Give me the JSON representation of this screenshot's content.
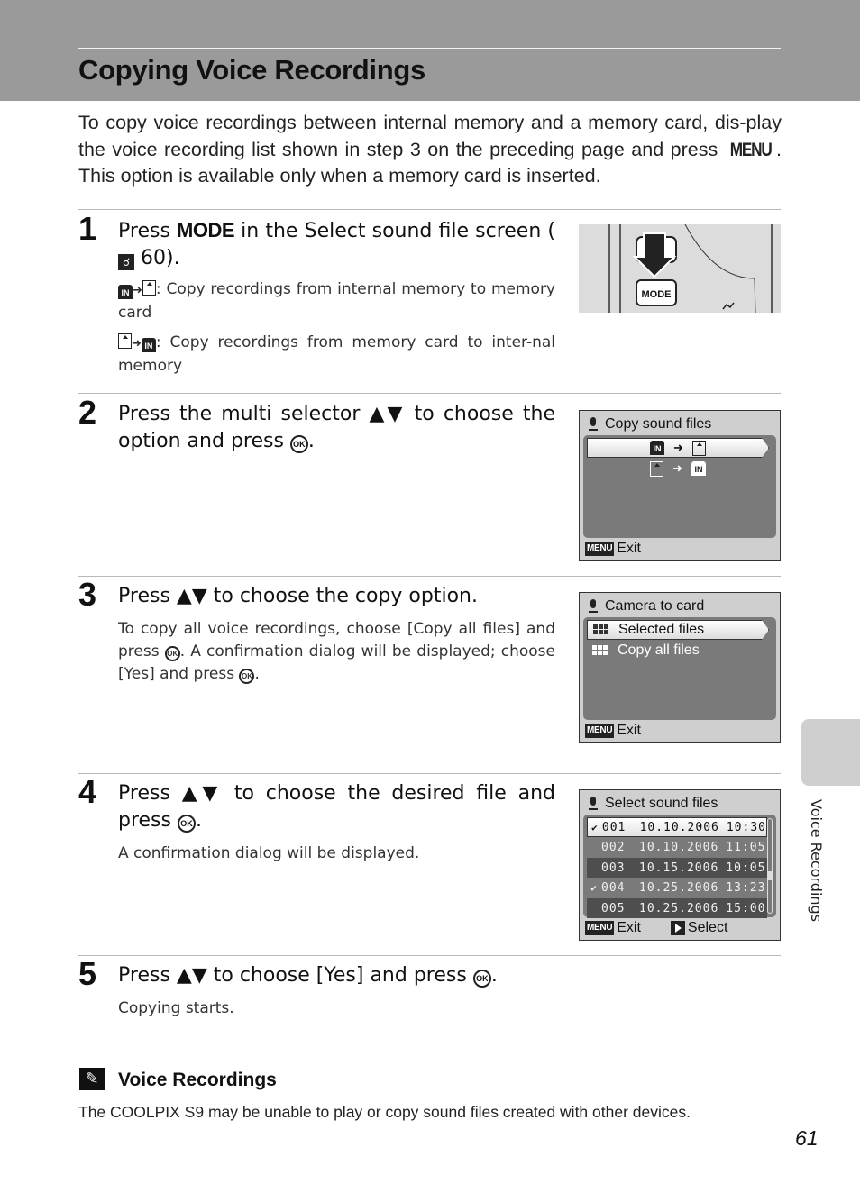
{
  "page": {
    "title": "Copying Voice Recordings",
    "intro_part1": "To copy voice recordings between internal memory and a memory card, dis-play the voice recording list shown in step 3 on the preceding page and press ",
    "intro_menu_key": "MENU",
    "intro_part2": ". This option is available only when a memory card is inserted.",
    "page_number": "61",
    "side_tab_label": "Voice Recordings"
  },
  "icons": {
    "ok": "OK",
    "in": "IN",
    "ref": "☌",
    "up_down": "▲▼",
    "arrow_right": "➜",
    "pencil": "✎",
    "check": "✔"
  },
  "steps": [
    {
      "number": "1",
      "title_pre": "Press ",
      "title_key": "MODE",
      "title_mid": " in the Select sound file screen (",
      "title_ref": "60",
      "title_post": ").",
      "body": [
        {
          "text": ": Copy recordings from internal memory to memory card"
        },
        {
          "text": ": Copy recordings from memory card to inter-nal memory"
        }
      ],
      "illustration": {
        "button_label": "MODE"
      }
    },
    {
      "number": "2",
      "title_pre": "Press the multi selector ",
      "title_mid": " to choose the option and press ",
      "title_post": ".",
      "screen": {
        "title": "Copy sound files",
        "options": [
          "Internal memory → card",
          "Card → internal memory"
        ],
        "selected_index": 0,
        "footer_key": "MENU",
        "footer_label": "Exit"
      }
    },
    {
      "number": "3",
      "title_pre": "Press ",
      "title_post": " to choose the copy option.",
      "body_pre": "To copy all voice recordings, choose [Copy all files] and press ",
      "body_mid": ". A confirmation dialog will be displayed; choose [Yes] and press ",
      "body_post": ".",
      "screen": {
        "title": "Camera to card",
        "options": [
          "Selected files",
          "Copy all files"
        ],
        "selected_index": 0,
        "footer_key": "MENU",
        "footer_label": "Exit"
      }
    },
    {
      "number": "4",
      "title_pre": "Press ",
      "title_mid": " to choose the desired file and press ",
      "title_post": ".",
      "body": "A confirmation dialog will be displayed.",
      "screen": {
        "title": "Select sound files",
        "files": [
          {
            "num": "001",
            "date": "10.10.2006",
            "time": "10:30",
            "checked": true,
            "selected": true
          },
          {
            "num": "002",
            "date": "10.10.2006",
            "time": "11:05",
            "checked": false,
            "selected": false
          },
          {
            "num": "003",
            "date": "10.15.2006",
            "time": "10:05",
            "checked": false,
            "selected": false
          },
          {
            "num": "004",
            "date": "10.25.2006",
            "time": "13:23",
            "checked": true,
            "selected": false
          },
          {
            "num": "005",
            "date": "10.25.2006",
            "time": "15:00",
            "checked": false,
            "selected": false
          }
        ],
        "footer_key": "MENU",
        "footer_label": "Exit",
        "footer_select_label": "Select"
      }
    },
    {
      "number": "5",
      "title_pre": "Press ",
      "title_mid": " to choose [Yes] and press ",
      "title_post": ".",
      "body": "Copying starts."
    }
  ],
  "note": {
    "title": "Voice Recordings",
    "text": "The COOLPIX S9 may be unable to play or copy sound files created with other devices."
  }
}
